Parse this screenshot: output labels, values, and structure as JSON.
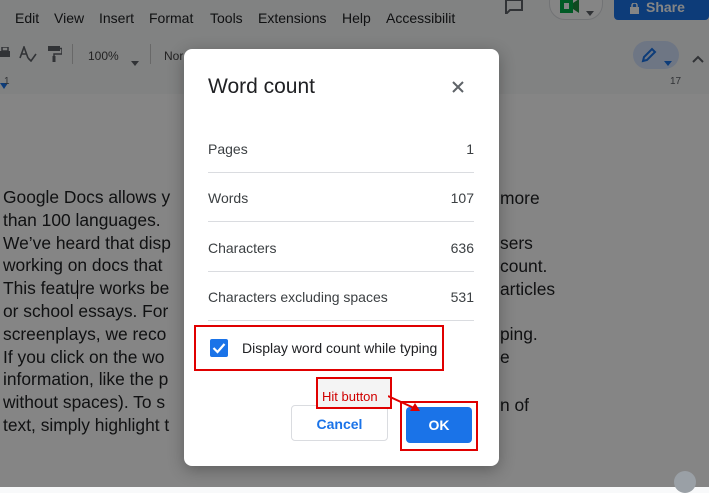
{
  "menu": {
    "items": [
      "Edit",
      "View",
      "Insert",
      "Format",
      "Tools",
      "Extensions",
      "Help",
      "Accessibilit"
    ],
    "share_label": "Share"
  },
  "toolbar": {
    "zoom": "100%",
    "style": "Nor"
  },
  "ruler": {
    "numbers": [
      "1",
      "17"
    ]
  },
  "document": {
    "lines": [
      "Google Docs allows y",
      "than 100 languages.",
      "We’ve heard that disp",
      "working on docs that",
      "This feature works be",
      "or school essays. For",
      "screenplays, we reco",
      "If you click on the wo",
      "information, like the p",
      "without spaces). To s",
      "text, simply highlight t"
    ],
    "right_fragments": [
      "more",
      "sers",
      "count.",
      "articles",
      "ping.",
      "e",
      "n of"
    ]
  },
  "dialog": {
    "title": "Word count",
    "stats": [
      {
        "label": "Pages",
        "value": "1"
      },
      {
        "label": "Words",
        "value": "107"
      },
      {
        "label": "Characters",
        "value": "636"
      },
      {
        "label": "Characters excluding spaces",
        "value": "531"
      }
    ],
    "checkbox_label": "Display word count while typing",
    "checkbox_checked": true,
    "cancel_label": "Cancel",
    "ok_label": "OK"
  },
  "annotation": {
    "hint": "Hit button"
  },
  "colors": {
    "accent": "#1a73e8",
    "annotation": "#e00000"
  }
}
